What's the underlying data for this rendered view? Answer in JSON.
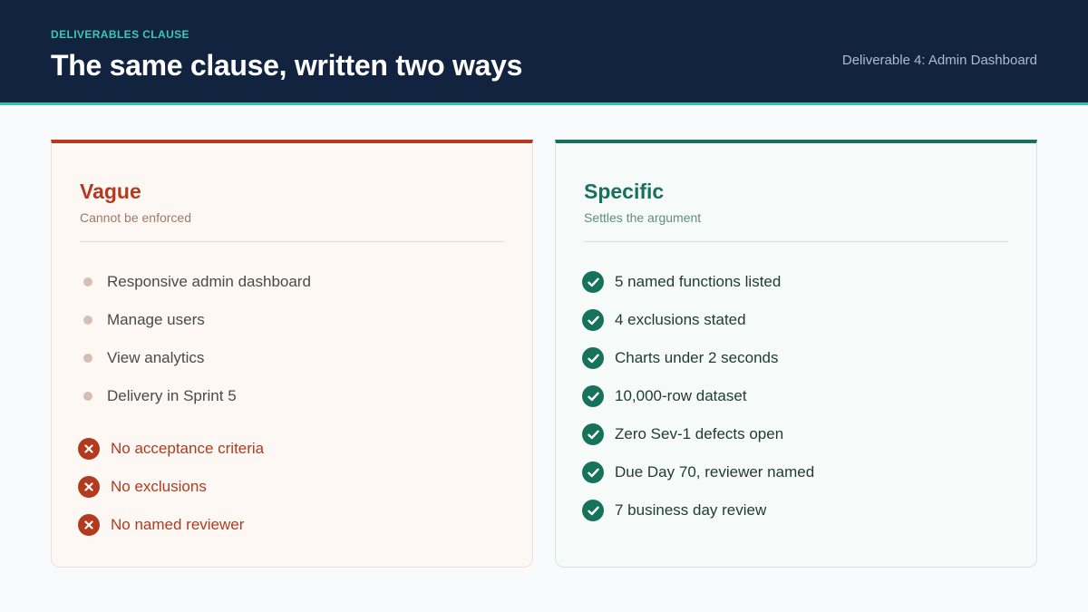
{
  "header": {
    "eyebrow": "DELIVERABLES CLAUSE",
    "title": "The same clause, written two ways",
    "meta": "Deliverable 4: Admin Dashboard",
    "background_color": "#11233F",
    "accent_color": "#38BFB0"
  },
  "vague": {
    "title": "Vague",
    "subtitle": "Cannot be enforced",
    "accent_color": "#B23A1E",
    "items": [
      "Responsive admin dashboard",
      "Manage users",
      "View analytics",
      "Delivery in Sprint 5"
    ],
    "problems": [
      "No acceptance criteria",
      "No exclusions",
      "No named reviewer"
    ],
    "problem_icon": "x-circle-icon"
  },
  "specific": {
    "title": "Specific",
    "subtitle": "Settles the argument",
    "accent_color": "#16725A",
    "items": [
      "5 named functions listed",
      "4 exclusions stated",
      "Charts under 2 seconds",
      "10,000-row dataset",
      "Zero Sev-1 defects open",
      "Due Day 70, reviewer named",
      "7 business day review"
    ],
    "item_icon": "check-circle-icon"
  }
}
